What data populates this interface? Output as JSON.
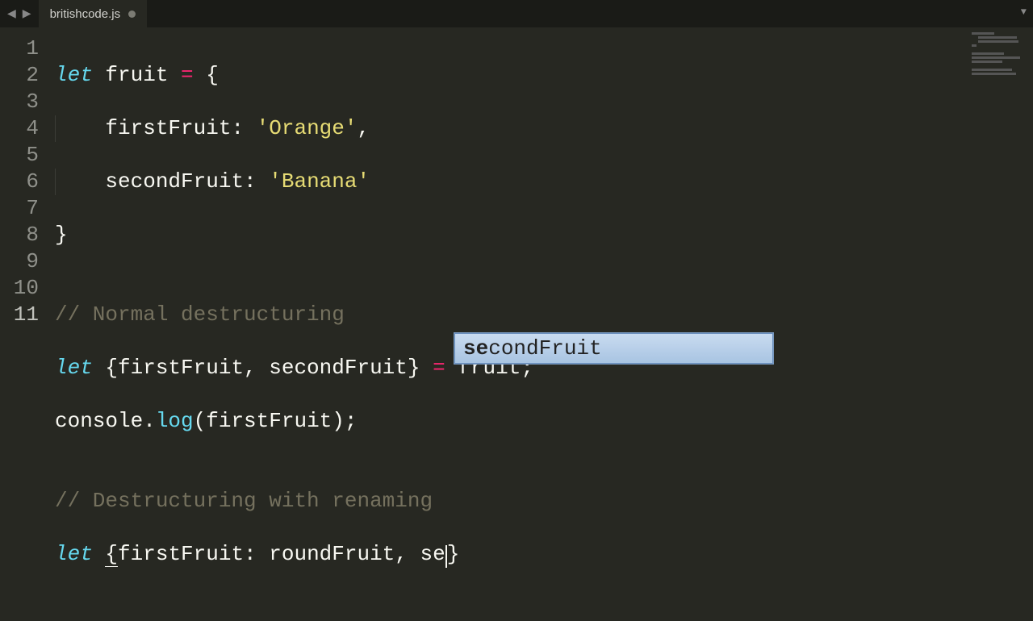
{
  "tab": {
    "title": "britishcode.js"
  },
  "gutter": [
    "1",
    "2",
    "3",
    "4",
    "5",
    "6",
    "7",
    "8",
    "9",
    "10",
    "11"
  ],
  "active_line_index": 10,
  "code": {
    "l1_kw": "let",
    "l1_name": " fruit ",
    "l1_eq": "=",
    "l1_rest": " {",
    "l2_indent": "    ",
    "l2_key": "firstFruit: ",
    "l2_str": "'Orange'",
    "l2_rest": ",",
    "l3_indent": "    ",
    "l3_key": "secondFruit: ",
    "l3_str": "'Banana'",
    "l4": "}",
    "l5": "",
    "l6_cmt": "// Normal destructuring",
    "l7_kw": "let",
    "l7_mid": " {firstFruit, secondFruit} ",
    "l7_eq": "=",
    "l7_rest": " fruit;",
    "l8_obj": "console.",
    "l8_fn": "log",
    "l8_rest": "(firstFruit);",
    "l9": "",
    "l10_cmt": "// Destructuring with renaming",
    "l11_kw": "let",
    "l11_a": " ",
    "l11_brace": "{",
    "l11_b": "firstFruit: roundFruit, se",
    "l11_c": "}"
  },
  "autocomplete": {
    "match": "se",
    "rest": "condFruit"
  }
}
